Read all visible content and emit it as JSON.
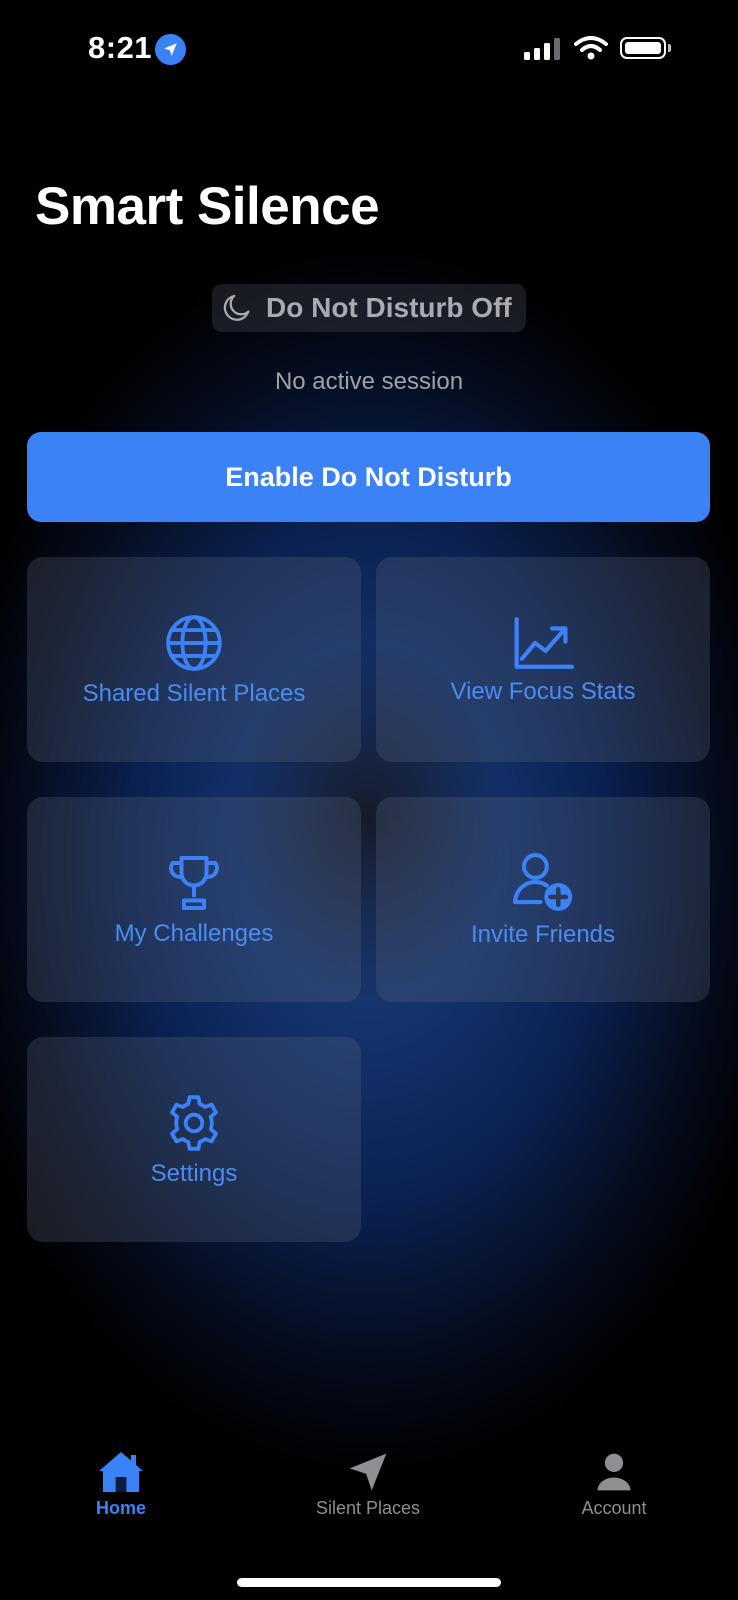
{
  "status_bar": {
    "time": "8:21",
    "location_icon": "location-arrow-icon",
    "signal_icon": "cellular-signal-icon",
    "wifi_icon": "wifi-icon",
    "battery_icon": "battery-icon"
  },
  "header": {
    "title": "Smart Silence"
  },
  "dnd_status": {
    "icon": "moon-icon",
    "label": "Do Not Disturb Off"
  },
  "session_text": "No active session",
  "primary_button": {
    "label": "Enable Do Not Disturb",
    "color": "#3b82f6"
  },
  "tiles": [
    {
      "icon": "globe-icon",
      "label": "Shared Silent Places"
    },
    {
      "icon": "chart-line-icon",
      "label": "View Focus Stats"
    },
    {
      "icon": "trophy-icon",
      "label": "My Challenges"
    },
    {
      "icon": "add-user-icon",
      "label": "Invite Friends"
    },
    {
      "icon": "gear-icon",
      "label": "Settings"
    }
  ],
  "tab_bar": {
    "items": [
      {
        "icon": "home-icon",
        "label": "Home",
        "active": true
      },
      {
        "icon": "navigation-arrow-icon",
        "label": "Silent Places",
        "active": false
      },
      {
        "icon": "person-icon",
        "label": "Account",
        "active": false
      }
    ],
    "active_color": "#3b82f6",
    "inactive_color": "#8e8e93"
  }
}
